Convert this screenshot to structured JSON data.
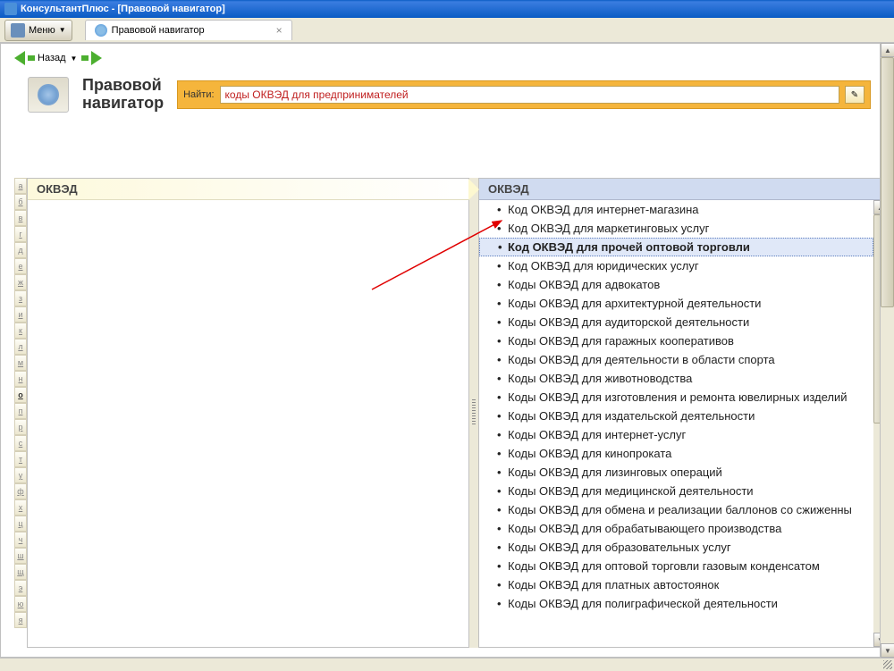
{
  "window": {
    "title": "КонсультантПлюс - [Правовой навигатор]"
  },
  "toolbar": {
    "menu_label": "Меню",
    "tab_label": "Правовой навигатор"
  },
  "nav": {
    "back_label": "Назад"
  },
  "page": {
    "title_line1": "Правовой",
    "title_line2": "навигатор"
  },
  "search": {
    "label": "Найти:",
    "value": "коды ОКВЭД для предпринимателей"
  },
  "left": {
    "header": "ОКВЭД"
  },
  "right": {
    "header": "ОКВЭД",
    "items": [
      "Код ОКВЭД для интернет-магазина",
      "Код ОКВЭД для маркетинговых услуг",
      "Код ОКВЭД для прочей оптовой торговли",
      "Код ОКВЭД для юридических услуг",
      "Коды ОКВЭД для адвокатов",
      "Коды ОКВЭД для архитектурной деятельности",
      "Коды ОКВЭД для аудиторской деятельности",
      "Коды ОКВЭД для гаражных кооперативов",
      "Коды ОКВЭД для деятельности в области спорта",
      "Коды ОКВЭД для животноводства",
      "Коды ОКВЭД для изготовления и ремонта ювелирных изделий",
      "Коды ОКВЭД для издательской деятельности",
      "Коды ОКВЭД для интернет-услуг",
      "Коды ОКВЭД для кинопроката",
      "Коды ОКВЭД для лизинговых операций",
      "Коды ОКВЭД для медицинской деятельности",
      "Коды ОКВЭД для обмена и реализации баллонов со сжиженны",
      "Коды ОКВЭД для обрабатывающего производства",
      "Коды ОКВЭД для образовательных услуг",
      "Коды ОКВЭД для оптовой торговли газовым конденсатом",
      "Коды ОКВЭД для платных автостоянок",
      "Коды ОКВЭД для полиграфической деятельности"
    ],
    "selected_index": 2
  },
  "alpha": [
    "а",
    "б",
    "в",
    "г",
    "д",
    "е",
    "ж",
    "з",
    "и",
    "к",
    "л",
    "м",
    "н",
    "о",
    "п",
    "р",
    "с",
    "т",
    "у",
    "ф",
    "х",
    "ц",
    "ч",
    "ш",
    "щ",
    "э",
    "ю",
    "я"
  ],
  "alpha_active": "о"
}
